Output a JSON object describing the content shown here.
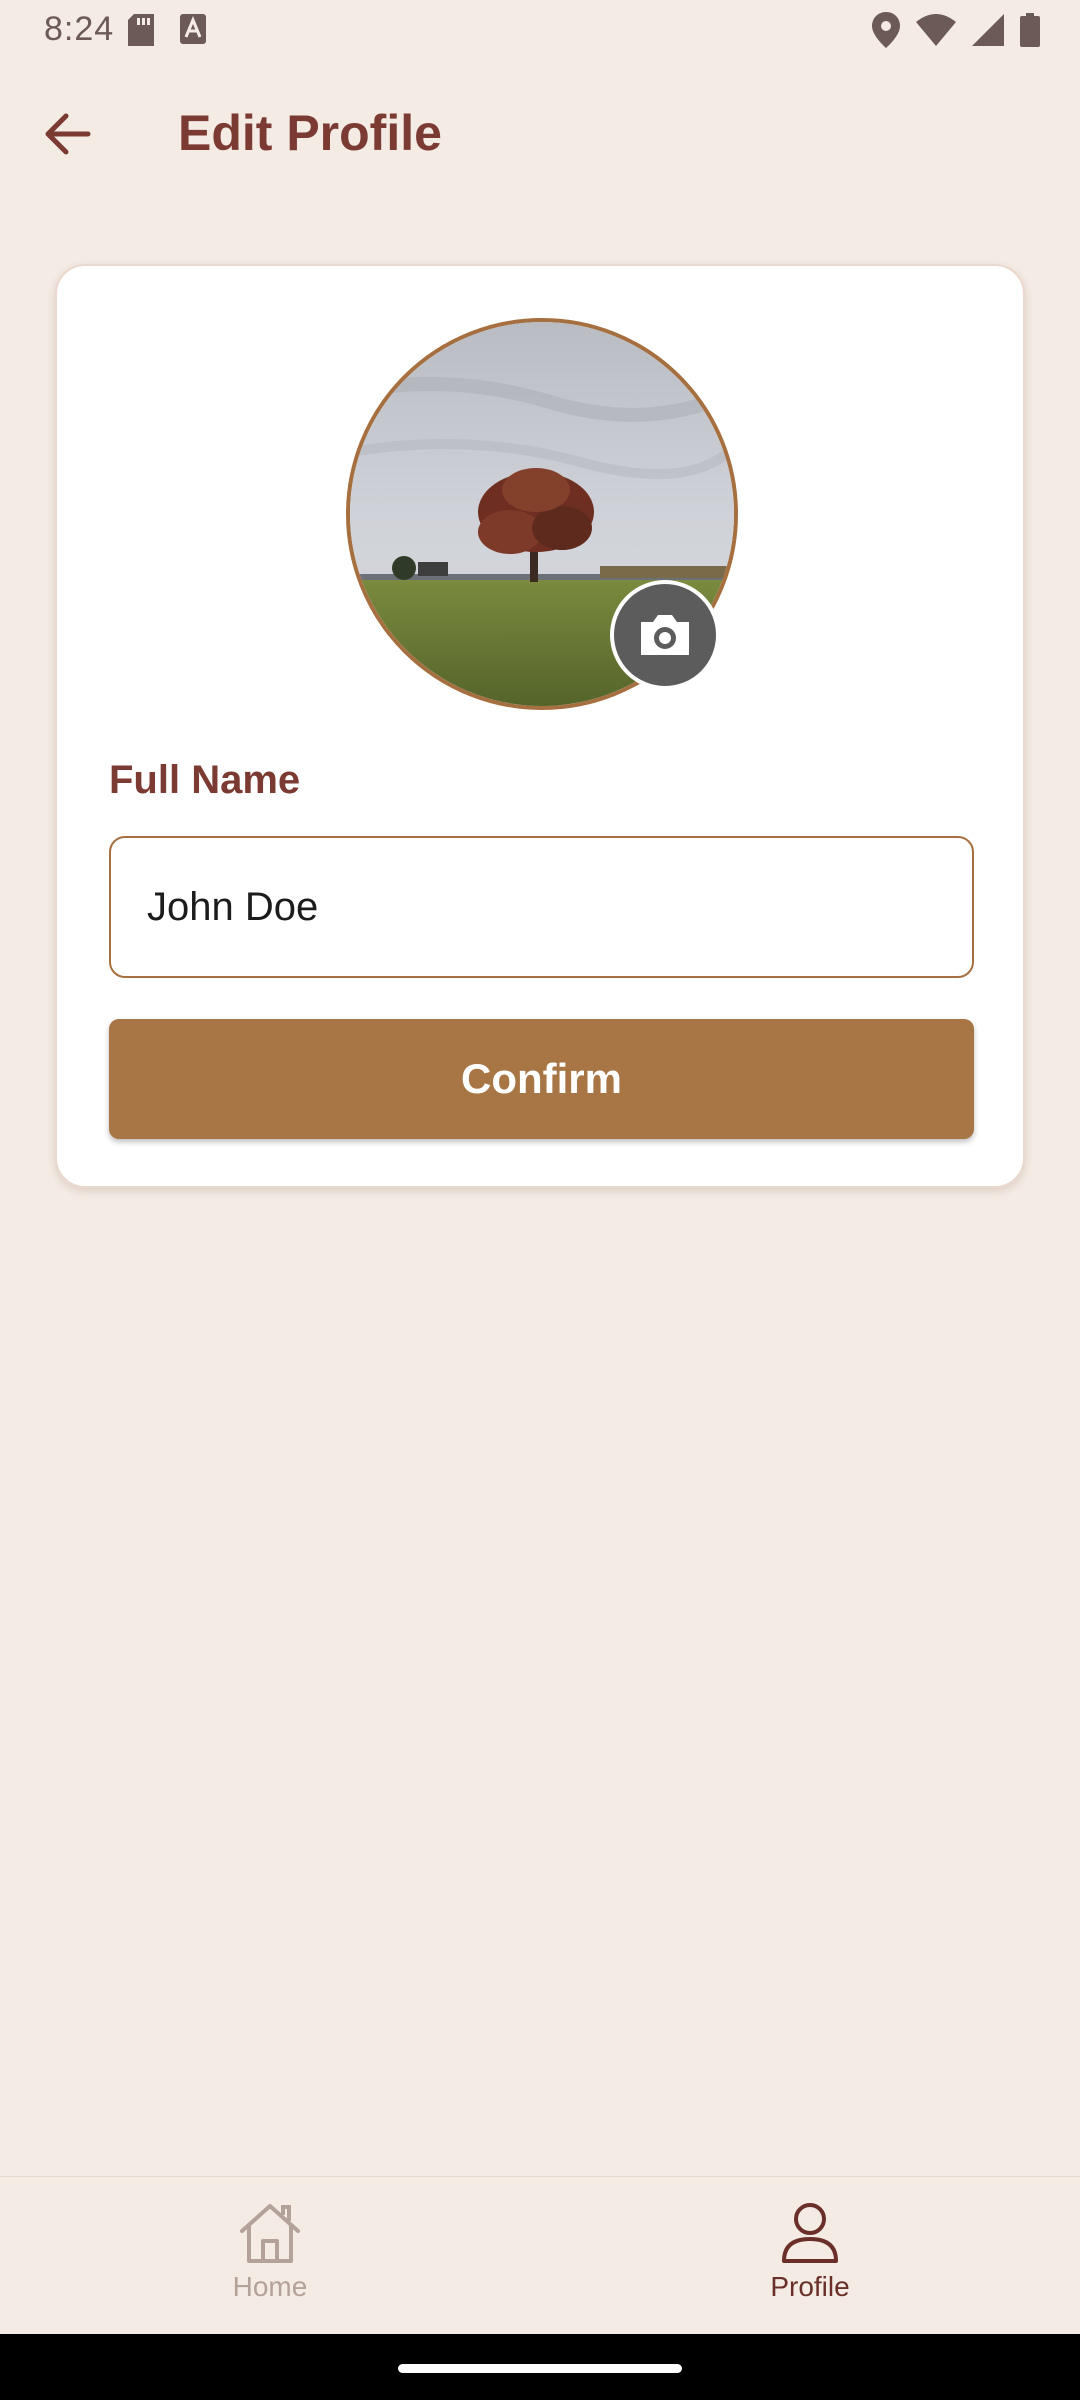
{
  "status_bar": {
    "time": "8:24",
    "icons": [
      "sd-card-icon",
      "keyboard-a-icon",
      "location-icon",
      "wifi-icon",
      "signal-icon",
      "battery-icon"
    ]
  },
  "app_bar": {
    "title": "Edit Profile",
    "back_icon": "arrow-back-icon"
  },
  "profile_card": {
    "avatar_alt": "Profile photo",
    "camera_icon": "camera-icon",
    "field_label": "Full Name",
    "name_value": "John Doe",
    "confirm_label": "Confirm"
  },
  "bottom_nav": {
    "items": [
      {
        "label": "Home",
        "icon": "home-icon",
        "active": false
      },
      {
        "label": "Profile",
        "icon": "person-icon",
        "active": true
      }
    ]
  },
  "colors": {
    "background": "#f3ebe4",
    "title": "#7b3a32",
    "accent": "#a87544",
    "nav_active": "#6b2f2a",
    "nav_inactive": "#b3a29a"
  }
}
